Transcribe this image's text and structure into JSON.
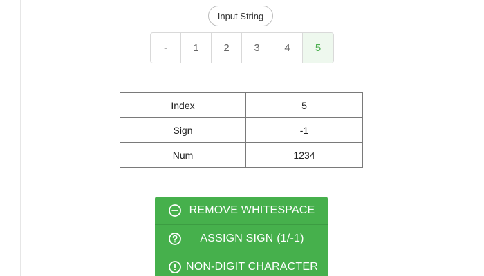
{
  "header": {
    "input_label": "Input String"
  },
  "input_chars": [
    {
      "char": "-",
      "active": false
    },
    {
      "char": "1",
      "active": false
    },
    {
      "char": "2",
      "active": false
    },
    {
      "char": "3",
      "active": false
    },
    {
      "char": "4",
      "active": false
    },
    {
      "char": "5",
      "active": true
    }
  ],
  "state_table": [
    {
      "key": "Index",
      "value": "5"
    },
    {
      "key": "Sign",
      "value": "-1"
    },
    {
      "key": "Num",
      "value": "1234"
    }
  ],
  "actions": [
    {
      "label": "REMOVE WHITESPACE",
      "icon": "minus-circle-icon"
    },
    {
      "label": "ASSIGN SIGN (1/-1)",
      "icon": "question-circle-icon"
    },
    {
      "label": "NON-DIGIT CHARACTER",
      "icon": "exclamation-circle-icon"
    }
  ],
  "colors": {
    "accent_green": "#46b04c",
    "active_char_bg": "#eef8ee",
    "active_char_text": "#4caf50"
  }
}
